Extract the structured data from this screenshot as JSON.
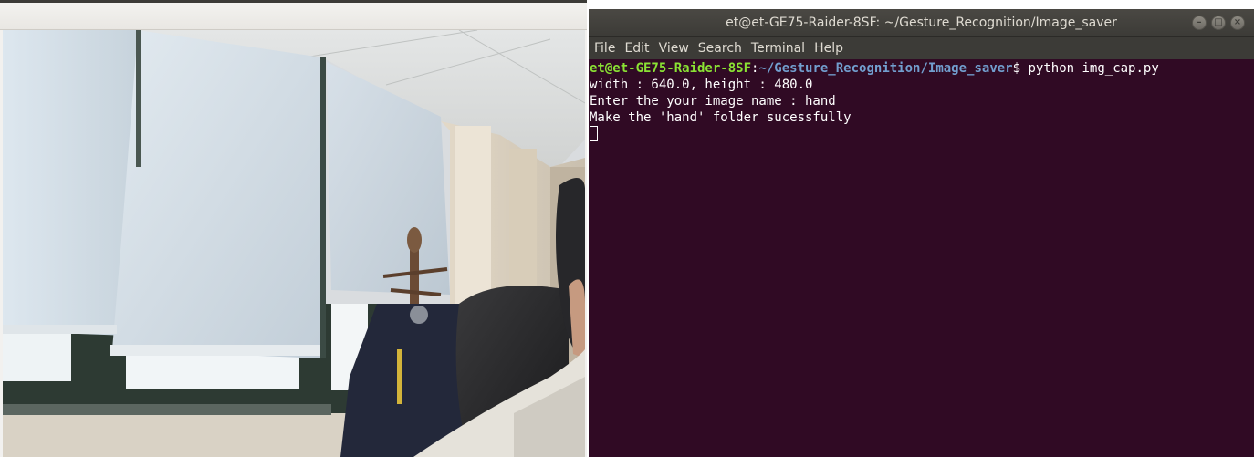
{
  "terminal": {
    "title": "et@et-GE75-Raider-8SF: ~/Gesture_Recognition/Image_saver",
    "menu": [
      "File",
      "Edit",
      "View",
      "Search",
      "Terminal",
      "Help"
    ],
    "prompt_user": "et@et-GE75-Raider-8SF",
    "prompt_sep": ":",
    "prompt_path": "~/Gesture_Recognition/Image_saver",
    "prompt_symbol": "$",
    "command": " python img_cap.py",
    "output": [
      "width : 640.0, height : 480.0",
      "Enter the your image name : hand",
      "Make the 'hand' folder sucessfully"
    ],
    "window_controls": [
      "minimize-icon",
      "maximize-icon",
      "close-icon"
    ],
    "colors": {
      "background": "#300a24",
      "prompt_user": "#8ae234",
      "prompt_path": "#729fcf",
      "text": "#ffffff"
    }
  },
  "camera": {
    "title": ""
  }
}
